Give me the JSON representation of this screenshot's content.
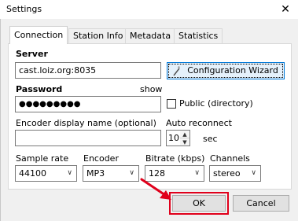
{
  "window": {
    "title": "Settings",
    "close_glyph": "✕"
  },
  "tabs": [
    {
      "label": "Connection",
      "active": true
    },
    {
      "label": "Station Info",
      "active": false
    },
    {
      "label": "Metadata",
      "active": false
    },
    {
      "label": "Statistics",
      "active": false
    }
  ],
  "connection": {
    "server_label": "Server",
    "server_value": "cast.loiz.org:8035",
    "wizard_label": "Configuration Wizard",
    "password_label": "Password",
    "show_label": "show",
    "password_value": "●●●●●●●●●",
    "public_label": "Public (directory)",
    "public_checked": false,
    "encoder_name_label": "Encoder display name (optional)",
    "encoder_name_value": "",
    "auto_reconnect_label": "Auto reconnect",
    "auto_reconnect_value": "10",
    "sec_label": "sec",
    "sample_rate_label": "Sample rate",
    "sample_rate_value": "44100",
    "encoder_label": "Encoder",
    "encoder_value": "MP3",
    "bitrate_label": "Bitrate (kbps)",
    "bitrate_value": "128",
    "channels_label": "Channels",
    "channels_value": "stereo"
  },
  "buttons": {
    "ok_label": "OK",
    "cancel_label": "Cancel"
  },
  "icons": {
    "dropdown": "chevron-down-icon",
    "spin_up": "spin-up-icon",
    "spin_down": "spin-down-icon",
    "wizard": "magic-wand-icon",
    "annotation": "red-arrow-annotation"
  },
  "colors": {
    "focus_highlight": "#e0001b",
    "wizard_border": "#0078d7",
    "wizard_bg": "#e5f1fb",
    "annotation_arrow": "#e0001b"
  }
}
